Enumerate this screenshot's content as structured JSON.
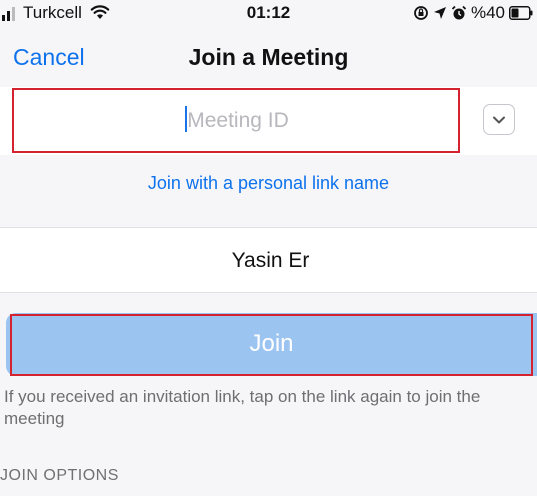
{
  "status_bar": {
    "carrier": "Turkcell",
    "time": "01:12",
    "battery": "%40"
  },
  "nav": {
    "cancel": "Cancel",
    "title": "Join a Meeting"
  },
  "meeting_id": {
    "value": "",
    "placeholder": "Meeting ID"
  },
  "personal_link_label": "Join with a personal link name",
  "name_field": {
    "value": "Yasin Er"
  },
  "join_button": {
    "label": "Join"
  },
  "hint": "If you received an invitation link, tap on the link again to join the meeting",
  "join_options_header": "JOIN OPTIONS",
  "colors": {
    "accent": "#0e72ed",
    "join_button_disabled": "#9cc4f1",
    "highlight_outline": "#d4232e"
  },
  "icons": [
    "signal-icon",
    "wifi-icon",
    "screen-lock-icon",
    "location-icon",
    "alarm-icon",
    "battery-icon",
    "chevron-down-icon"
  ]
}
